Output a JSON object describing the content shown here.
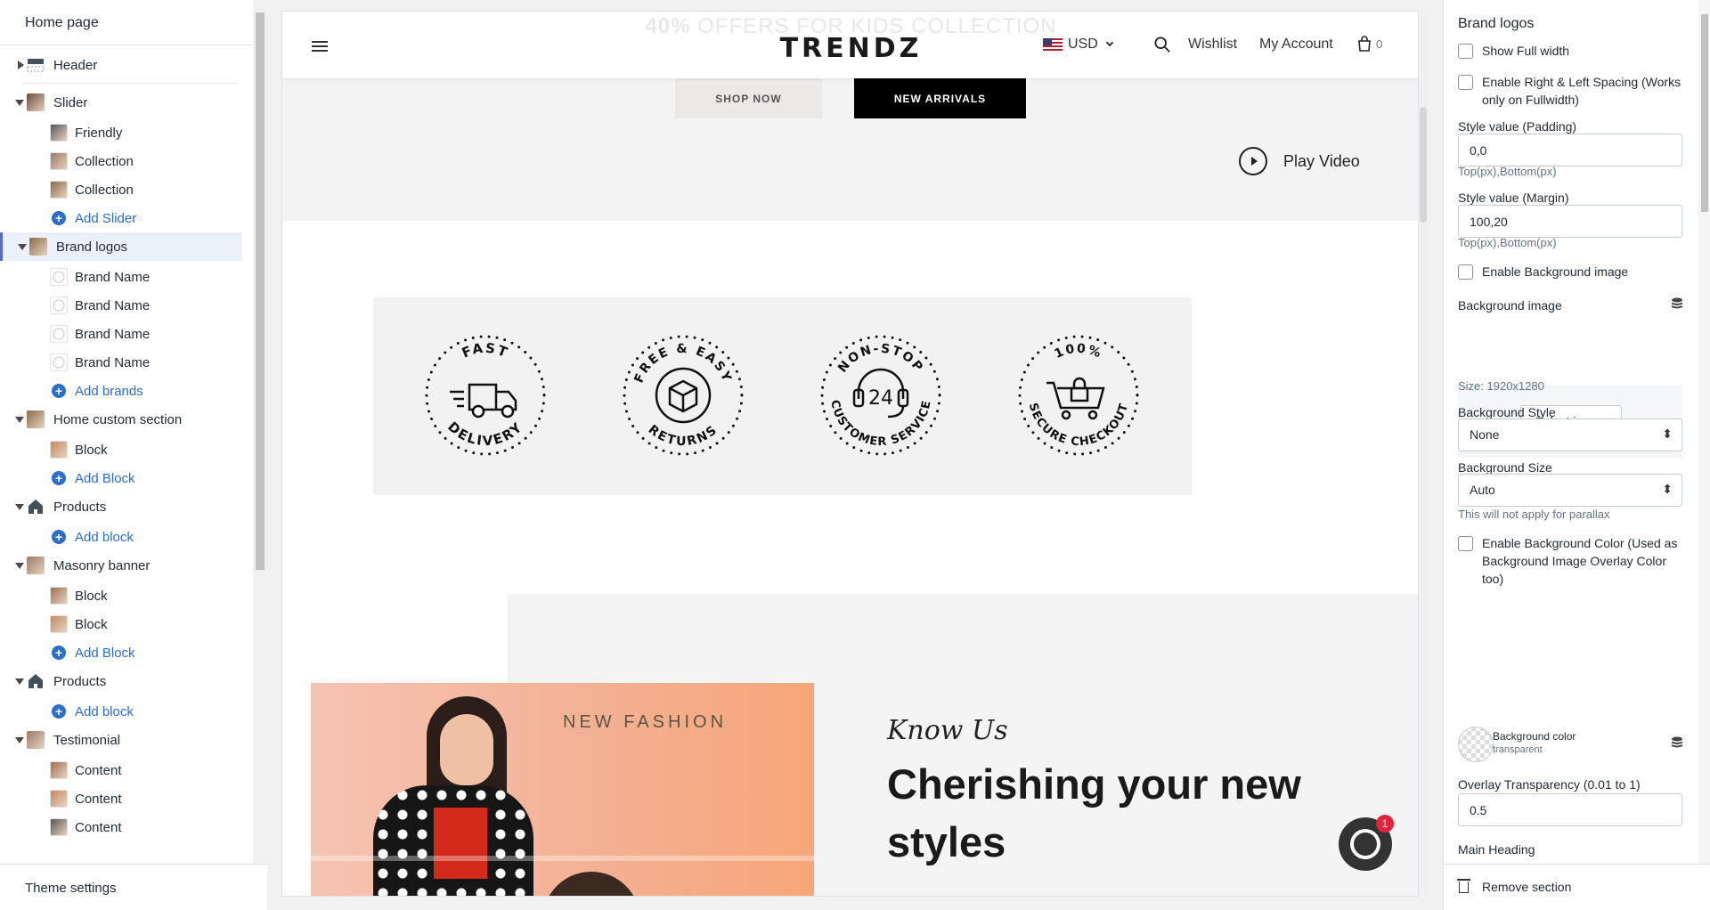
{
  "left": {
    "title": "Home page",
    "footer": "Theme settings",
    "tree": [
      {
        "label": "Header",
        "kind": "section",
        "collapsed": true
      },
      {
        "label": "Slider",
        "kind": "section"
      },
      {
        "label": "Friendly",
        "kind": "child"
      },
      {
        "label": "Collection",
        "kind": "child"
      },
      {
        "label": "Collection",
        "kind": "child"
      },
      {
        "label": "Add Slider",
        "kind": "add"
      },
      {
        "label": "Brand logos",
        "kind": "section",
        "selected": true
      },
      {
        "label": "Brand Name",
        "kind": "child"
      },
      {
        "label": "Brand Name",
        "kind": "child"
      },
      {
        "label": "Brand Name",
        "kind": "child"
      },
      {
        "label": "Brand Name",
        "kind": "child"
      },
      {
        "label": "Add brands",
        "kind": "add"
      },
      {
        "label": "Home custom section",
        "kind": "section"
      },
      {
        "label": "Block",
        "kind": "child"
      },
      {
        "label": "Add Block",
        "kind": "add"
      },
      {
        "label": "Products",
        "kind": "section",
        "icon": "store-icon"
      },
      {
        "label": "Add block",
        "kind": "add"
      },
      {
        "label": "Masonry banner",
        "kind": "section"
      },
      {
        "label": "Block",
        "kind": "child"
      },
      {
        "label": "Block",
        "kind": "child"
      },
      {
        "label": "Add Block",
        "kind": "add"
      },
      {
        "label": "Products",
        "kind": "section",
        "icon": "store-icon"
      },
      {
        "label": "Add block",
        "kind": "add"
      },
      {
        "label": "Testimonial",
        "kind": "section"
      },
      {
        "label": "Content",
        "kind": "child"
      },
      {
        "label": "Content",
        "kind": "child"
      },
      {
        "label": "Content",
        "kind": "child"
      }
    ]
  },
  "store": {
    "promo_bold": "40%",
    "promo_rest": " OFFERS FOR KIDS COLLECTION",
    "logo": "TRENDZ",
    "currency": "USD",
    "wishlist": "Wishlist",
    "account": "My Account",
    "cart_count": "0",
    "shop_now": "SHOP NOW",
    "new_arrivals": "NEW ARRIVALS",
    "play_video": "Play Video",
    "features": [
      {
        "top": "FAST",
        "bottom": "DELIVERY",
        "icon": "truck-icon"
      },
      {
        "top": "FREE & EASY",
        "bottom": "RETURNS",
        "icon": "box-icon"
      },
      {
        "top": "NON-STOP",
        "bottom": "CUSTOMER SERVICE",
        "icon": "headset-icon",
        "center": "24"
      },
      {
        "top": "100%",
        "bottom": "SECURE CHECKOUT",
        "icon": "cart-lock-icon"
      }
    ],
    "new_fashion": "NEW FASHION",
    "know_us": "Know Us",
    "cherish": "Cherishing your new styles",
    "chat_badge": "1"
  },
  "right": {
    "title": "Brand logos",
    "show_full_width": "Show Full width",
    "enable_spacing": "Enable Right & Left Spacing (Works only on Fullwidth)",
    "padding_label": "Style value (Padding)",
    "padding_value": "0,0",
    "padding_help": "Top(px),Bottom(px)",
    "margin_label": "Style value (Margin)",
    "margin_value": "100,20",
    "margin_help": "Top(px),Bottom(px)",
    "enable_bg_image": "Enable Background image",
    "bg_image_label": "Background image",
    "select_image": "Select image",
    "size_help": "Size: 1920x1280",
    "bg_style_label": "Background Style",
    "bg_style_value": "None",
    "bg_size_label": "Background Size",
    "bg_size_value": "Auto",
    "parallax_help": "This will not apply for parallax",
    "enable_bg_color": "Enable Background Color (Used as Background Image Overlay Color too)",
    "bg_color_label": "Background color",
    "bg_color_value": "transparent",
    "overlay_label": "Overlay Transparency (0.01 to 1)",
    "overlay_value": "0.5",
    "main_heading_label": "Main Heading",
    "remove_section": "Remove section"
  }
}
